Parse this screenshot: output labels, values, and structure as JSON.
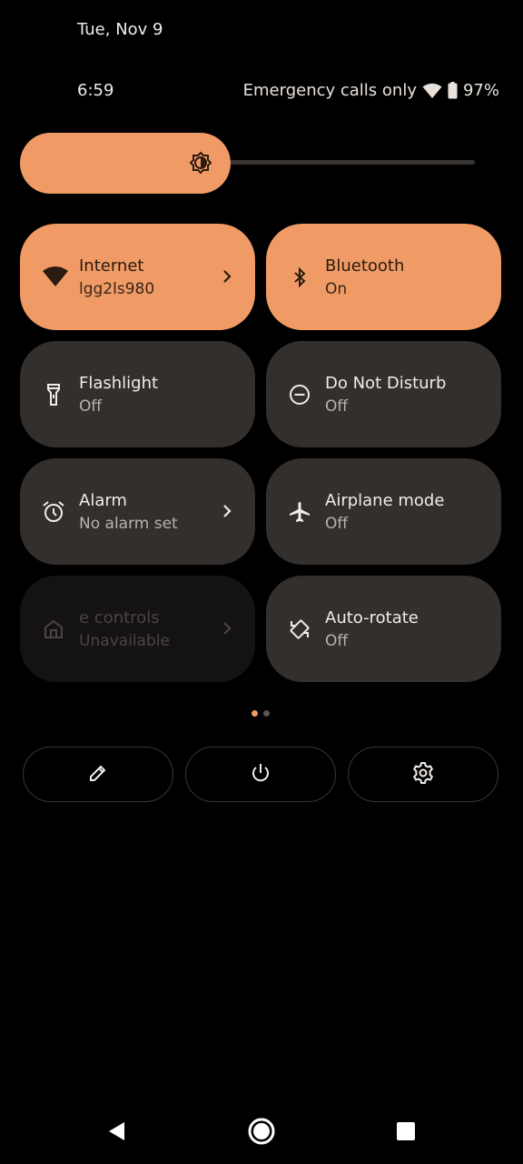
{
  "status": {
    "date": "Tue, Nov 9",
    "time": "6:59",
    "carrier": "Emergency calls only",
    "battery_percent": "97%"
  },
  "brightness": {
    "level": 0.41,
    "icon": "brightness-icon"
  },
  "tiles": [
    {
      "label": "Internet",
      "sub": "lgg2ls980",
      "icon": "wifi-icon",
      "state": "active",
      "chevron": true
    },
    {
      "label": "Bluetooth",
      "sub": "On",
      "icon": "bluetooth-icon",
      "state": "active",
      "chevron": false
    },
    {
      "label": "Flashlight",
      "sub": "Off",
      "icon": "flashlight-icon",
      "state": "off",
      "chevron": false
    },
    {
      "label": "Do Not Disturb",
      "sub": "Off",
      "icon": "do-not-disturb-icon",
      "state": "off",
      "chevron": false
    },
    {
      "label": "Alarm",
      "sub": "No alarm set",
      "icon": "alarm-icon",
      "state": "off",
      "chevron": true
    },
    {
      "label": "Airplane mode",
      "sub": "Off",
      "icon": "airplane-icon",
      "state": "off",
      "chevron": false
    },
    {
      "label": "e controls",
      "sub": "Unavailable",
      "icon": "home-icon",
      "state": "disabled",
      "chevron": true
    },
    {
      "label": "Auto-rotate",
      "sub": "Off",
      "icon": "auto-rotate-icon",
      "state": "off",
      "chevron": false
    }
  ],
  "page_indicator": {
    "pages": 2,
    "current": 1
  },
  "actions": [
    {
      "icon": "edit-icon"
    },
    {
      "icon": "power-icon"
    },
    {
      "icon": "settings-icon"
    }
  ],
  "colors": {
    "accent": "#f09b65",
    "tile_off": "#332f2d",
    "background": "#000000"
  }
}
